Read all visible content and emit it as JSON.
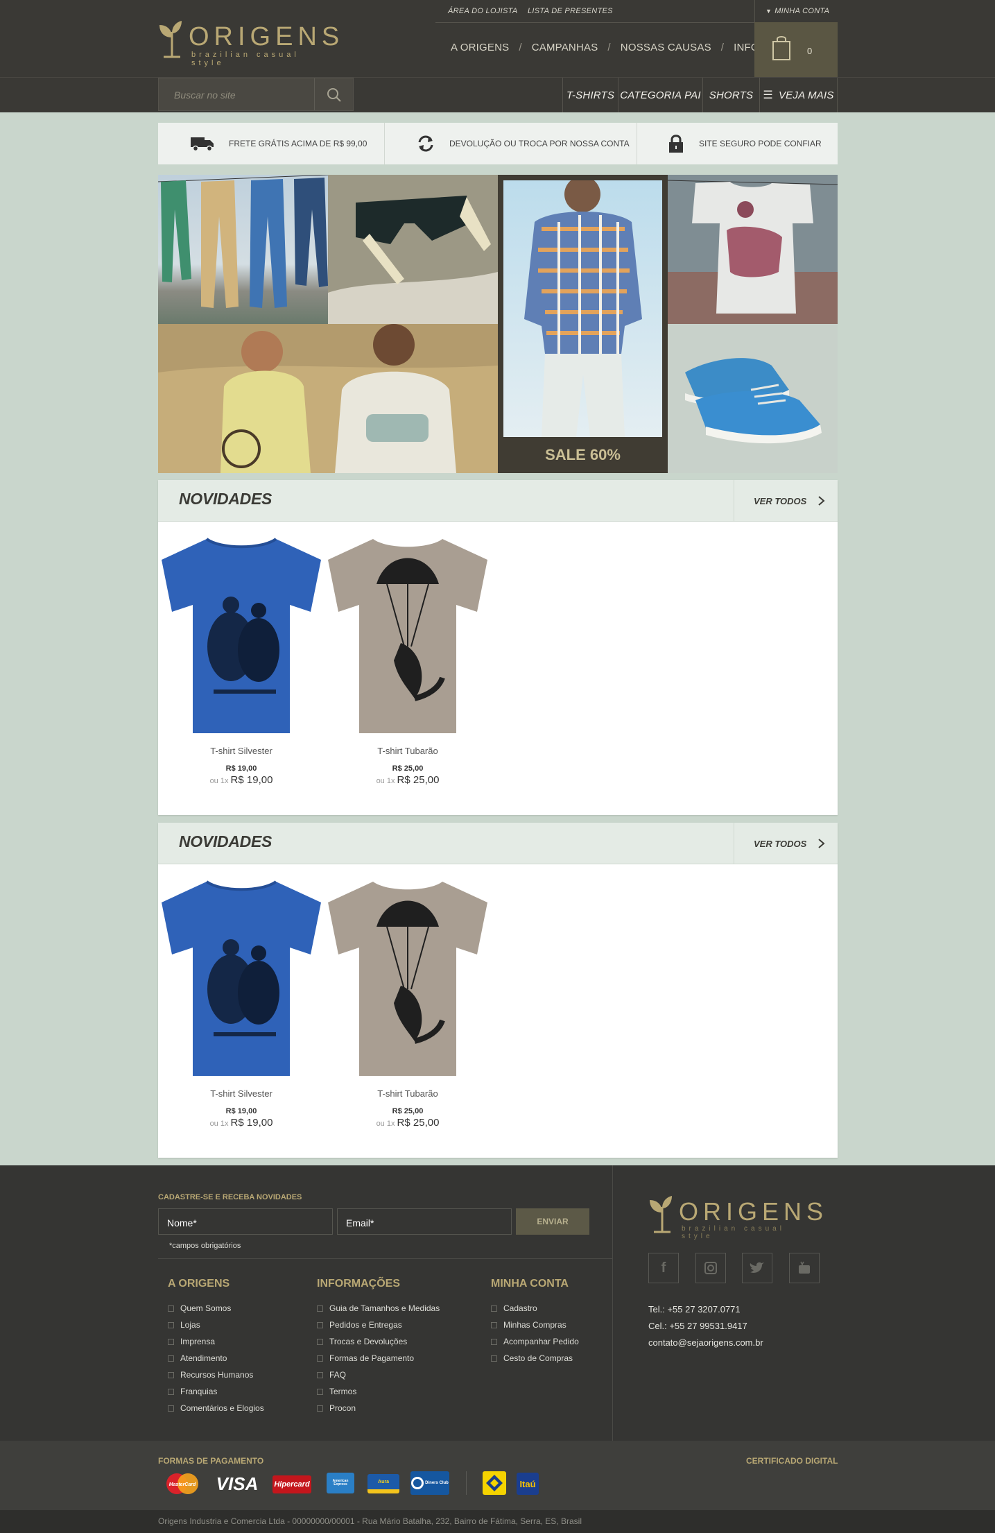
{
  "header": {
    "logo_word": "ORIGENS",
    "logo_tagline": "brazilian casual style",
    "top_links": [
      "ÁREA DO LOJISTA",
      "LISTA DE PRESENTES"
    ],
    "account_label": "MINHA CONTA",
    "main_nav": [
      "A ORIGENS",
      "CAMPANHAS",
      "NOSSAS CAUSAS",
      "INFORMAÇÕES"
    ],
    "cart_count": "0",
    "search_placeholder": "Buscar no site",
    "categories": [
      "T-SHIRTS",
      "CATEGORIA PAI",
      "SHORTS"
    ],
    "more_label": "VEJA MAIS"
  },
  "benefits": [
    {
      "icon": "truck-icon",
      "text": "FRETE GRÁTIS ACIMA DE R$ 99,00"
    },
    {
      "icon": "exchange-icon",
      "text": "DEVOLUÇÃO OU TROCA POR NOSSA CONTA"
    },
    {
      "icon": "lock-icon",
      "text": "SITE SEGURO PODE CONFIAR"
    }
  ],
  "banner": {
    "sale_label": "SALE 60%"
  },
  "sections": [
    {
      "title": "NOVIDADES",
      "see_all": "VER TODOS",
      "products": [
        {
          "name": "T-shirt Silvester",
          "price": "R$ 19,00",
          "inst_prefix": "ou 1x",
          "inst_value": "R$ 19,00"
        },
        {
          "name": "T-shirt Tubarão",
          "price": "R$ 25,00",
          "inst_prefix": "ou 1x",
          "inst_value": "R$ 25,00"
        }
      ]
    },
    {
      "title": "NOVIDADES",
      "see_all": "VER TODOS",
      "products": [
        {
          "name": "T-shirt Silvester",
          "price": "R$ 19,00",
          "inst_prefix": "ou 1x",
          "inst_value": "R$ 19,00"
        },
        {
          "name": "T-shirt Tubarão",
          "price": "R$ 25,00",
          "inst_prefix": "ou 1x",
          "inst_value": "R$ 25,00"
        }
      ]
    }
  ],
  "footer": {
    "newsletter_title": "CADASTRE-SE E RECEBA NOVIDADES",
    "name_placeholder": "Nome*",
    "email_placeholder": "Email*",
    "send_label": "ENVIAR",
    "required_note": "*campos obrigatórios",
    "columns": [
      {
        "title": "A ORIGENS",
        "items": [
          "Quem Somos",
          "Lojas",
          "Imprensa",
          "Atendimento",
          "Recursos Humanos",
          "Franquias",
          "Comentários e Elogios"
        ]
      },
      {
        "title": "INFORMAÇÕES",
        "items": [
          "Guia de Tamanhos e Medidas",
          "Pedidos e Entregas",
          "Trocas e Devoluções",
          "Formas de Pagamento",
          "FAQ",
          "Termos",
          "Procon"
        ]
      },
      {
        "title": "MINHA CONTA",
        "items": [
          "Cadastro",
          "Minhas Compras",
          "Acompanhar Pedido",
          "Cesto de Compras"
        ]
      }
    ],
    "contact": {
      "tel": "Tel.: +55 27 3207.0771",
      "cel": "Cel.: +55 27 99531.9417",
      "email": "contato@sejaorigens.com.br"
    },
    "payment_title": "FORMAS DE PAGAMENTO",
    "cert_title": "CERTIFICADO DIGITAL",
    "payment_cards": [
      "MasterCard",
      "VISA",
      "Hipercard",
      "American Express",
      "Aura",
      "Diners Club",
      "Banco do Brasil",
      "Itaú"
    ],
    "copyright": "Origens Industria e Comercia Ltda - 00000000/00001 - Rua Mário Batalha, 232, Bairro de Fátima, Serra, ES, Brasil"
  },
  "colors": {
    "accent": "#b9a874",
    "dark": "#3a3935",
    "page_bg": "#c9d6cc"
  }
}
